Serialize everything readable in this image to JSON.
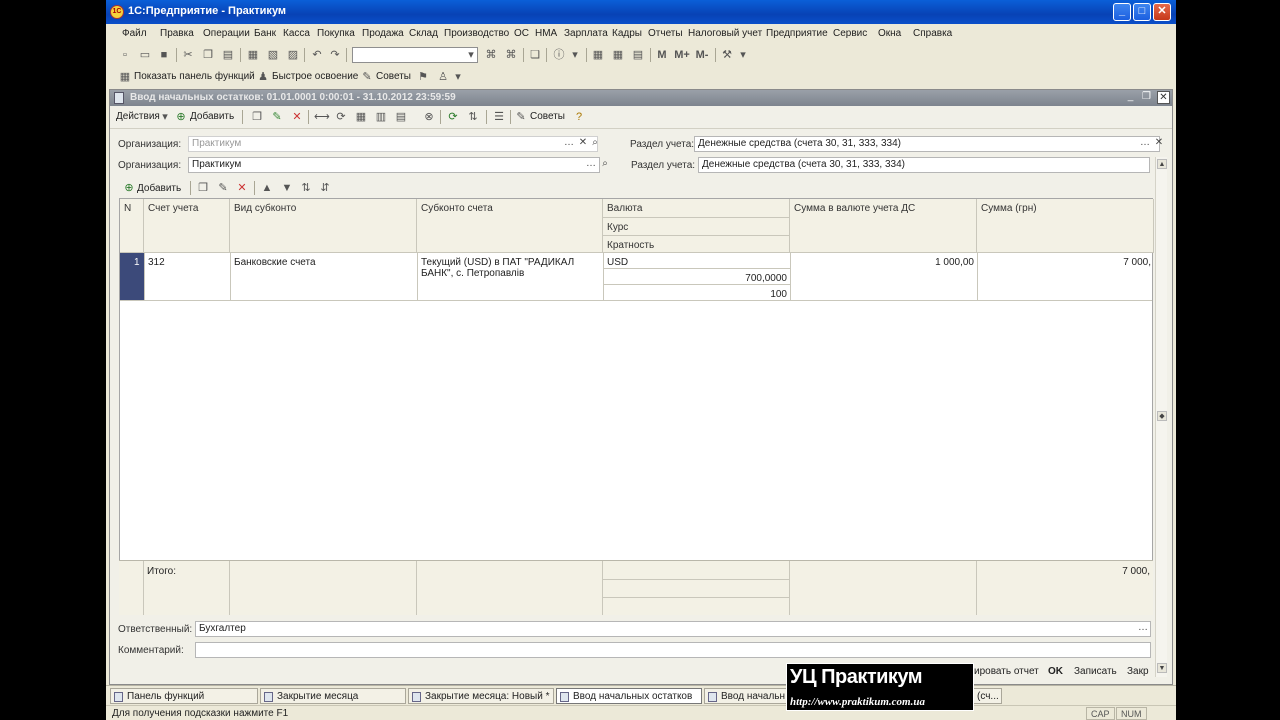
{
  "window": {
    "title": "1С:Предприятие - Практикум",
    "icon_label": "1С"
  },
  "menu": [
    "Файл",
    "Правка",
    "Операции",
    "Банк",
    "Касса",
    "Покупка",
    "Продажа",
    "Склад",
    "Производство",
    "ОС",
    "НМА",
    "Зарплата",
    "Кадры",
    "Отчеты",
    "Налоговый учет",
    "Предприятие",
    "Сервис",
    "Окна",
    "Справка"
  ],
  "panel_toolbar": {
    "show_panel": "Показать панель функций",
    "quick_learn": "Быстрое освоение",
    "tips": "Советы"
  },
  "doc": {
    "title": "Ввод начальных остатков: 01.01.0001 0:00:01 - 31.10.2012 23:59:59",
    "actions_label": "Действия",
    "add_label": "Добавить",
    "tips_label": "Советы",
    "org_label_1": "Организация:",
    "org_value_1": "Практикум",
    "section_label_1": "Раздел учета:",
    "section_value_1": "Денежные средства (счета 30, 31, 333, 334)",
    "org_label_2": "Организация:",
    "org_value_2": "Практикум",
    "section_label_2": "Раздел учета:",
    "section_value_2": "Денежные средства (счета 30, 31, 333, 334)",
    "table_add_label": "Добавить"
  },
  "table": {
    "headers": {
      "n": "N",
      "account": "Счет учета",
      "subconto_kind": "Вид субконто",
      "subconto": "Субконто счета",
      "currency": "Валюта",
      "rate": "Курс",
      "multiplicity": "Кратность",
      "sum_currency": "Сумма в валюте учета ДС",
      "sum_uah": "Сумма (грн)"
    },
    "rows": [
      {
        "n": "1",
        "account": "312",
        "subconto_kind": "Банковские счета",
        "subconto_line1": "Текущий (USD) в ПАТ \"РАДИКАЛ",
        "subconto_line2": "БАНК\", с. Петропавлів",
        "currency": "USD",
        "rate": "700,0000",
        "multiplicity": "100",
        "sum_currency": "1 000,00",
        "sum_uah": "7 000,"
      }
    ],
    "total_label": "Итого:",
    "total_uah": "7 000,"
  },
  "footer": {
    "responsible_label": "Ответственный:",
    "responsible_value": "Бухгалтер",
    "comment_label": "Комментарий:",
    "comment_value": "",
    "print_report": "ировать отчет",
    "ok": "OK",
    "save": "Записать",
    "close": "Закр"
  },
  "tasks": [
    "Панель функций",
    "Закрытие месяца",
    "Закрытие месяца: Новый *",
    "Ввод начальных остатков",
    "Ввод начальн",
    "(сч..."
  ],
  "status": {
    "hint": "Для получения подсказки нажмите F1",
    "cap": "CAP",
    "num": "NUM"
  },
  "watermark": {
    "line1": "УЦ Практикум",
    "line2": "http://www.praktikum.com.ua"
  }
}
